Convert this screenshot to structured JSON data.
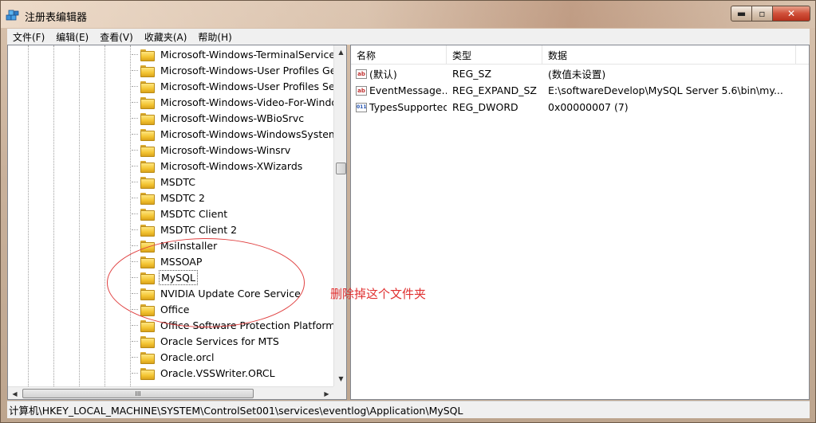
{
  "window": {
    "title": "注册表编辑器",
    "controls": {
      "minimize": "▬",
      "maximize": "▫",
      "close": "✕"
    }
  },
  "menu": [
    {
      "label": "文件(F)"
    },
    {
      "label": "编辑(E)"
    },
    {
      "label": "查看(V)"
    },
    {
      "label": "收藏夹(A)"
    },
    {
      "label": "帮助(H)"
    }
  ],
  "tree": {
    "items": [
      {
        "label": "Microsoft-Windows-TerminalServices-C"
      },
      {
        "label": "Microsoft-Windows-User Profiles Gene"
      },
      {
        "label": "Microsoft-Windows-User Profiles Servic"
      },
      {
        "label": "Microsoft-Windows-Video-For-Window"
      },
      {
        "label": "Microsoft-Windows-WBioSrvc"
      },
      {
        "label": "Microsoft-Windows-WindowsSystemAs"
      },
      {
        "label": "Microsoft-Windows-Winsrv"
      },
      {
        "label": "Microsoft-Windows-XWizards"
      },
      {
        "label": "MSDTC"
      },
      {
        "label": "MSDTC 2"
      },
      {
        "label": "MSDTC Client"
      },
      {
        "label": "MSDTC Client 2"
      },
      {
        "label": "MsiInstaller"
      },
      {
        "label": "MSSOAP"
      },
      {
        "label": "MySQL",
        "selected": true
      },
      {
        "label": "NVIDIA Update Core Service"
      },
      {
        "label": "Office"
      },
      {
        "label": "Office Software Protection Platform Ser"
      },
      {
        "label": "Oracle Services for MTS"
      },
      {
        "label": "Oracle.orcl"
      },
      {
        "label": "Oracle.VSSWriter.ORCL"
      }
    ],
    "scroll": {
      "up_arrow": "▲",
      "down_arrow": "▼",
      "left_arrow": "◀",
      "right_arrow": "▶",
      "thumb_grip": "III"
    }
  },
  "list": {
    "columns": [
      "名称",
      "类型",
      "数据"
    ],
    "rows": [
      {
        "icon": "ab",
        "name": "(默认)",
        "type": "REG_SZ",
        "data": "(数值未设置)"
      },
      {
        "icon": "ab",
        "name": "EventMessage...",
        "type": "REG_EXPAND_SZ",
        "data": "E:\\softwareDevelop\\MySQL Server 5.6\\bin\\my..."
      },
      {
        "icon": "011",
        "name": "TypesSupported",
        "type": "REG_DWORD",
        "data": "0x00000007 (7)"
      }
    ]
  },
  "annotation": {
    "text": "删除掉这个文件夹",
    "color": "#e03030"
  },
  "status": {
    "path": "计算机\\HKEY_LOCAL_MACHINE\\SYSTEM\\ControlSet001\\services\\eventlog\\Application\\MySQL"
  }
}
